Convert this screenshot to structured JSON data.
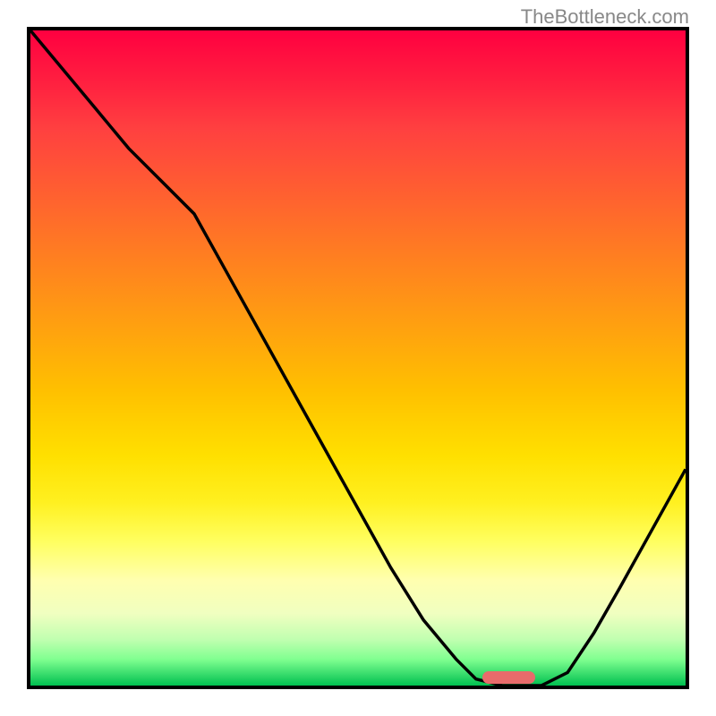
{
  "watermark": "TheBottleneck.com",
  "chart_data": {
    "type": "line",
    "title": "",
    "xlabel": "",
    "ylabel": "",
    "xlim": [
      0,
      100
    ],
    "ylim": [
      0,
      100
    ],
    "x": [
      0,
      5,
      10,
      15,
      20,
      25,
      30,
      35,
      40,
      45,
      50,
      55,
      60,
      65,
      68,
      72,
      75,
      78,
      82,
      86,
      90,
      95,
      100
    ],
    "values": [
      100,
      94,
      88,
      82,
      77,
      72,
      63,
      54,
      45,
      36,
      27,
      18,
      10,
      4,
      1,
      0,
      0,
      0,
      2,
      8,
      15,
      24,
      33
    ],
    "marker": {
      "x": 73,
      "y": 0,
      "width": 8,
      "color": "#e86b6b"
    },
    "gradient_colors": {
      "top": "#ff0040",
      "mid": "#ffe000",
      "bottom": "#00c050"
    }
  }
}
